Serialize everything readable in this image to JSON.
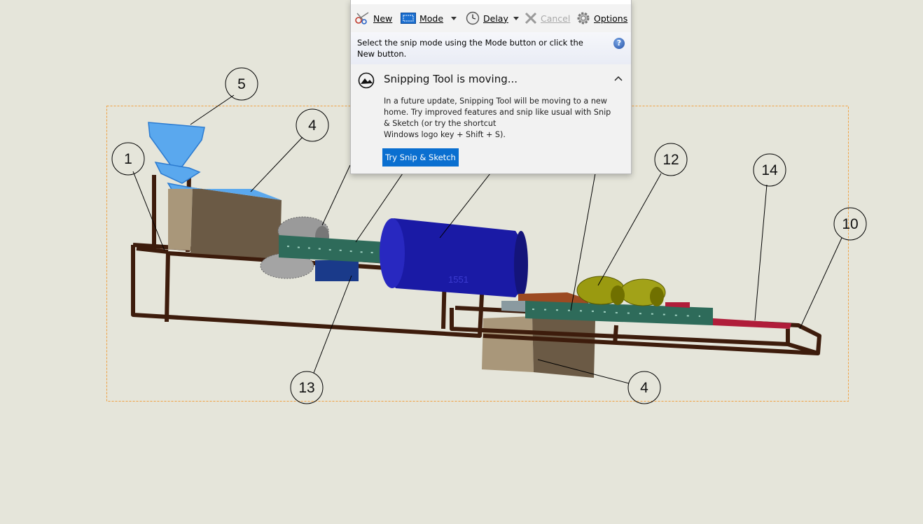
{
  "snipping_tool": {
    "toolbar": {
      "new_label": "New",
      "mode_label": "Mode",
      "delay_label": "Delay",
      "cancel_label": "Cancel",
      "options_label": "Options"
    },
    "hint": "Select the snip mode using the Mode button or click the New button.",
    "help_glyph": "?",
    "notice": {
      "title": "Snipping Tool is moving...",
      "body_lines": [
        "In a future update, Snipping Tool will be moving to a new",
        "home. Try improved features and snip like usual with Snip",
        "& Sketch (or try the shortcut",
        "Windows logo key + Shift + S)."
      ],
      "button_label": "Try Snip & Sketch"
    }
  },
  "drawing": {
    "balloons": [
      "5",
      "4",
      "1",
      "12",
      "14",
      "10",
      "13",
      "4"
    ],
    "colors": {
      "background": "#e5e5da",
      "frame": "#3d1c0c",
      "hopper": "#5aa8ee",
      "box": "#6b5a45",
      "motor": "#1a1aa5",
      "conveyor": "#2e6b5a",
      "rollers": "#9a9a2a",
      "cutters": "#b01d3a",
      "selection_border": "#f0a040"
    }
  }
}
